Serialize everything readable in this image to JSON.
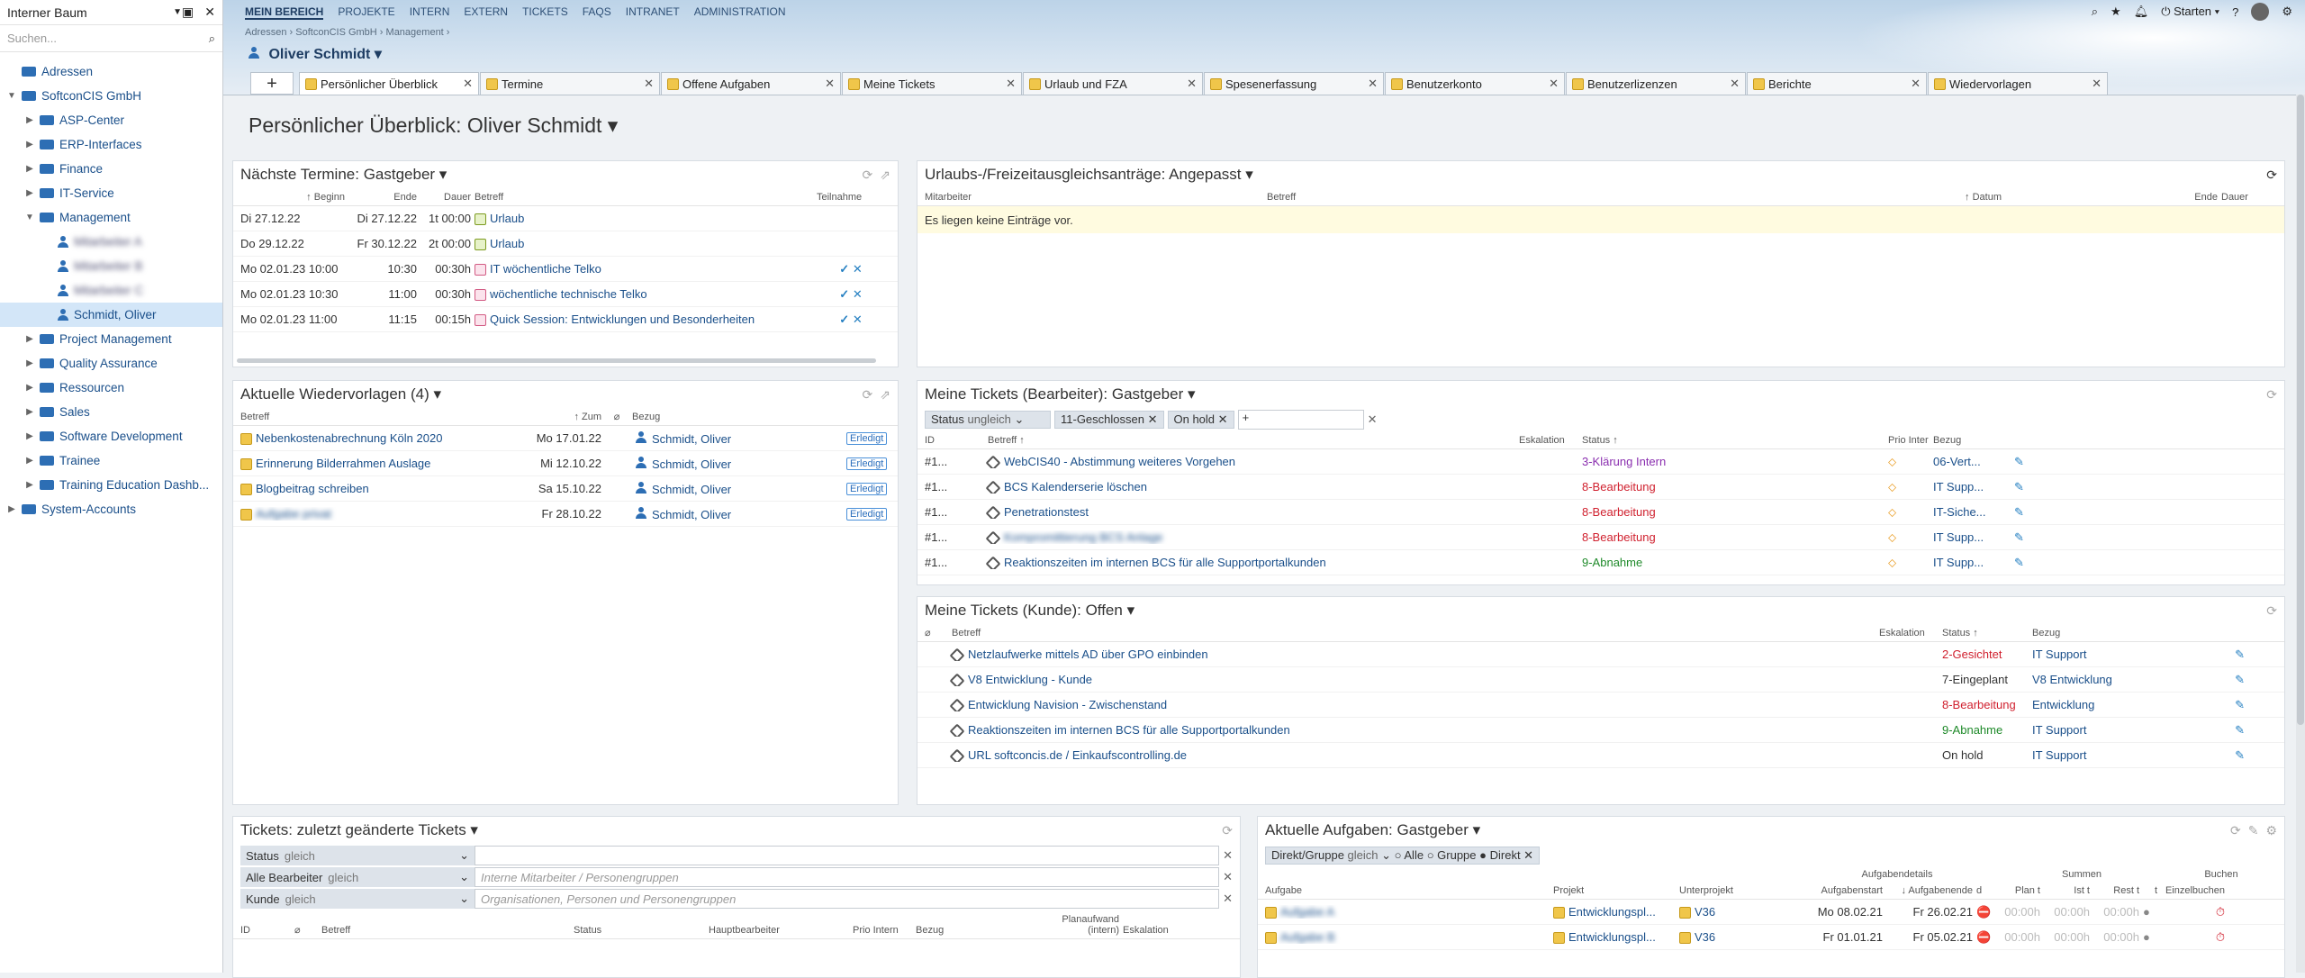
{
  "sidebar": {
    "title": "Interner Baum",
    "search_placeholder": "Suchen...",
    "items": [
      {
        "label": "Adressen",
        "indent": 0,
        "type": "root"
      },
      {
        "label": "SoftconCIS GmbH",
        "indent": 0,
        "type": "org",
        "expanded": true
      },
      {
        "label": "ASP-Center",
        "indent": 1,
        "type": "folder"
      },
      {
        "label": "ERP-Interfaces",
        "indent": 1,
        "type": "folder"
      },
      {
        "label": "Finance",
        "indent": 1,
        "type": "folder"
      },
      {
        "label": "IT-Service",
        "indent": 1,
        "type": "folder"
      },
      {
        "label": "Management",
        "indent": 1,
        "type": "folder",
        "expanded": true
      },
      {
        "label": "Mitarbeiter A",
        "indent": 2,
        "type": "user",
        "blurred": true
      },
      {
        "label": "Mitarbeiter B",
        "indent": 2,
        "type": "user",
        "blurred": true
      },
      {
        "label": "Mitarbeiter C",
        "indent": 2,
        "type": "user",
        "blurred": true
      },
      {
        "label": "Schmidt, Oliver",
        "indent": 2,
        "type": "user",
        "selected": true
      },
      {
        "label": "Project Management",
        "indent": 1,
        "type": "folder"
      },
      {
        "label": "Quality Assurance",
        "indent": 1,
        "type": "folder"
      },
      {
        "label": "Ressourcen",
        "indent": 1,
        "type": "folder"
      },
      {
        "label": "Sales",
        "indent": 1,
        "type": "folder"
      },
      {
        "label": "Software Development",
        "indent": 1,
        "type": "folder"
      },
      {
        "label": "Trainee",
        "indent": 1,
        "type": "folder"
      },
      {
        "label": "Training Education Dashb...",
        "indent": 1,
        "type": "folder"
      },
      {
        "label": "System-Accounts",
        "indent": 0,
        "type": "org"
      }
    ]
  },
  "nav": {
    "items": [
      "MEIN BEREICH",
      "PROJEKTE",
      "INTERN",
      "EXTERN",
      "TICKETS",
      "FAQS",
      "INTRANET",
      "ADMINISTRATION"
    ],
    "active": "MEIN BEREICH"
  },
  "breadcrumb": [
    "Adressen",
    "SoftconCIS GmbH",
    "Management"
  ],
  "person": "Oliver Schmidt",
  "tools": {
    "start_label": "Starten"
  },
  "tabs": [
    "Persönlicher Überblick",
    "Termine",
    "Offene Aufgaben",
    "Meine Tickets",
    "Urlaub und FZA",
    "Spesenerfassung",
    "Benutzerkonto",
    "Benutzerlizenzen",
    "Berichte",
    "Wiedervorlagen"
  ],
  "page_title": "Persönlicher Überblick: Oliver Schmidt",
  "termine": {
    "title": "Nächste Termine: Gastgeber",
    "cols": {
      "beginn": "Beginn",
      "ende": "Ende",
      "dauer": "Dauer",
      "betreff": "Betreff",
      "teilnahme": "Teilnahme"
    },
    "rows": [
      {
        "beginn": "Di 27.12.22",
        "ende": "Di 27.12.22",
        "dauer": "1t 00:00",
        "betreff": "Urlaub",
        "icon": "vacation"
      },
      {
        "beginn": "Do 29.12.22",
        "ende": "Fr 30.12.22",
        "dauer": "2t 00:00",
        "betreff": "Urlaub",
        "icon": "vacation"
      },
      {
        "beginn": "Mo 02.01.23 10:00",
        "ende": "10:30",
        "dauer": "00:30h",
        "betreff": "IT wöchentliche Telko",
        "icon": "meeting",
        "actions": true
      },
      {
        "beginn": "Mo 02.01.23 10:30",
        "ende": "11:00",
        "dauer": "00:30h",
        "betreff": "wöchentliche technische Telko",
        "icon": "meeting",
        "actions": true
      },
      {
        "beginn": "Mo 02.01.23 11:00",
        "ende": "11:15",
        "dauer": "00:15h",
        "betreff": "Quick Session: Entwicklungen und Besonderheiten",
        "icon": "meeting",
        "actions": true
      }
    ]
  },
  "urlaub": {
    "title": "Urlaubs-/Freizeitausgleichsanträge: Angepasst",
    "cols": {
      "mitarbeiter": "Mitarbeiter",
      "betreff": "Betreff",
      "datum": "Datum",
      "ende": "Ende",
      "dauer": "Dauer"
    },
    "empty": "Es liegen keine Einträge vor."
  },
  "wiedervorlagen": {
    "title": "Aktuelle Wiedervorlagen (4)",
    "cols": {
      "betreff": "Betreff",
      "zum": "Zum",
      "bezug": "Bezug"
    },
    "rows": [
      {
        "betreff": "Nebenkostenabrechnung Köln 2020",
        "zum": "Mo 17.01.22",
        "bezug": "Schmidt, Oliver",
        "status": "Erledigt"
      },
      {
        "betreff": "Erinnerung Bilderrahmen Auslage",
        "zum": "Mi 12.10.22",
        "bezug": "Schmidt, Oliver",
        "status": "Erledigt"
      },
      {
        "betreff": "Blogbeitrag schreiben",
        "zum": "Sa 15.10.22",
        "bezug": "Schmidt, Oliver",
        "status": "Erledigt"
      },
      {
        "betreff": "Aufgabe privat",
        "zum": "Fr 28.10.22",
        "bezug": "Schmidt, Oliver",
        "status": "Erledigt",
        "blurred": true
      }
    ]
  },
  "tickets_bearbeiter": {
    "title": "Meine Tickets (Bearbeiter): Gastgeber",
    "filter": {
      "label": "Status",
      "op": "ungleich",
      "chips": [
        "11-Geschlossen",
        "On hold"
      ]
    },
    "cols": {
      "id": "ID",
      "betreff": "Betreff",
      "eskalation": "Eskalation",
      "status": "Status",
      "prio": "Prio Inter",
      "bezug": "Bezug"
    },
    "rows": [
      {
        "id": "#1...",
        "betreff": "WebCIS40 - Abstimmung weiteres Vorgehen",
        "status": "3-Klärung Intern",
        "status_color": "purp",
        "bezug": "06-Vert..."
      },
      {
        "id": "#1...",
        "betreff": "BCS Kalenderserie löschen",
        "status": "8-Bearbeitung",
        "status_color": "red",
        "bezug": "IT Supp..."
      },
      {
        "id": "#1...",
        "betreff": "Penetrationstest",
        "status": "8-Bearbeitung",
        "status_color": "red",
        "bezug": "IT-Siche..."
      },
      {
        "id": "#1...",
        "betreff": "Kompromittierung BCS Anlage",
        "status": "8-Bearbeitung",
        "status_color": "red",
        "bezug": "IT Supp...",
        "blurred": true
      },
      {
        "id": "#1...",
        "betreff": "Reaktionszeiten im internen BCS für alle Supportportalkunden",
        "status": "9-Abnahme",
        "status_color": "grn",
        "bezug": "IT Supp..."
      }
    ]
  },
  "tickets_kunde": {
    "title": "Meine Tickets (Kunde): Offen",
    "cols": {
      "betreff": "Betreff",
      "eskalation": "Eskalation",
      "status": "Status",
      "bezug": "Bezug"
    },
    "rows": [
      {
        "betreff": "Netzlaufwerke mittels AD über GPO einbinden",
        "status": "2-Gesichtet",
        "status_color": "red",
        "bezug": "IT Support"
      },
      {
        "betreff": "V8 Entwicklung - Kunde",
        "status": "7-Eingeplant",
        "status_color": "",
        "bezug": "V8 Entwicklung"
      },
      {
        "betreff": "Entwicklung Navision - Zwischenstand",
        "status": "8-Bearbeitung",
        "status_color": "red",
        "bezug": "Entwicklung"
      },
      {
        "betreff": "Reaktionszeiten im internen BCS für alle Supportportalkunden",
        "status": "9-Abnahme",
        "status_color": "grn",
        "bezug": "IT Support"
      },
      {
        "betreff": "URL softconcis.de / Einkaufscontrolling.de",
        "status": "On hold",
        "status_color": "",
        "bezug": "IT Support"
      }
    ]
  },
  "tickets_geaendert": {
    "title": "Tickets: zuletzt geänderte Tickets",
    "filters": [
      {
        "label": "Status",
        "op": "gleich",
        "placeholder": ""
      },
      {
        "label": "Alle Bearbeiter",
        "op": "gleich",
        "placeholder": "Interne Mitarbeiter / Personengruppen"
      },
      {
        "label": "Kunde",
        "op": "gleich",
        "placeholder": "Organisationen, Personen und Personengruppen"
      }
    ],
    "cols": {
      "id": "ID",
      "betreff": "Betreff",
      "status": "Status",
      "hauptbearbeiter": "Hauptbearbeiter",
      "prio": "Prio Intern",
      "bezug": "Bezug",
      "plan": "Planaufwand (intern)",
      "eskalation": "Eskalation"
    }
  },
  "aufgaben": {
    "title": "Aktuelle Aufgaben: Gastgeber",
    "filter": {
      "label": "Direkt/Gruppe",
      "op": "gleich",
      "options": [
        "Alle",
        "Gruppe",
        "Direkt"
      ],
      "selected": "Direkt"
    },
    "groups": {
      "details": "Aufgabendetails",
      "summen": "Summen",
      "buchen": "Buchen"
    },
    "cols": {
      "aufgabe": "Aufgabe",
      "projekt": "Projekt",
      "unterprojekt": "Unterprojekt",
      "start": "Aufgabenstart",
      "ende": "Aufgabenende",
      "d": "d",
      "plan": "Plan t",
      "ist": "Ist t",
      "rest": "Rest t",
      "t": "t",
      "einzel": "Einzelbuchen"
    },
    "rows": [
      {
        "aufgabe": "Aufgabe A",
        "projekt": "Entwicklungspl...",
        "unterprojekt": "V36",
        "start": "Mo 08.02.21",
        "ende": "Fr 26.02.21",
        "plan": "00:00h",
        "ist": "00:00h",
        "rest": "00:00h"
      },
      {
        "aufgabe": "Aufgabe B",
        "projekt": "Entwicklungspl...",
        "unterprojekt": "V36",
        "start": "Fr 01.01.21",
        "ende": "Fr 05.02.21",
        "plan": "00:00h",
        "ist": "00:00h",
        "rest": "00:00h"
      }
    ]
  }
}
